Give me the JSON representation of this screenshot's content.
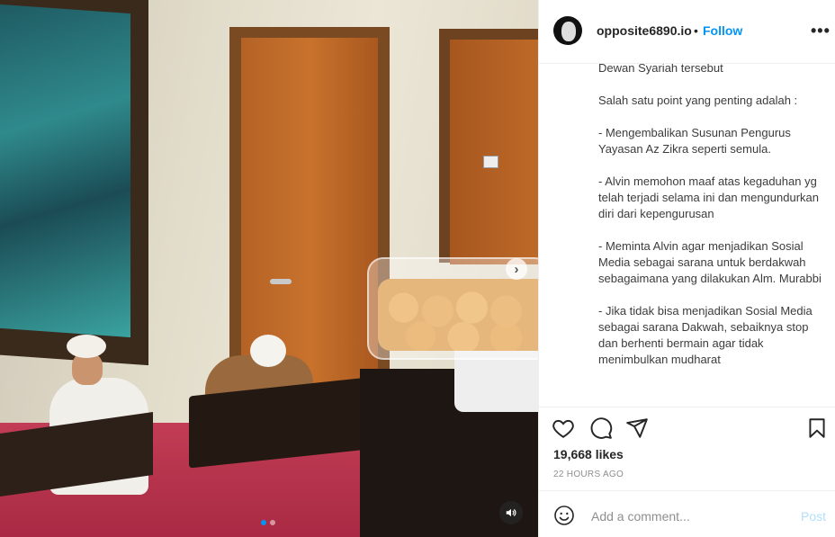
{
  "post": {
    "username": "opposite6890.io",
    "separator": "•",
    "follow_label": "Follow",
    "more_label": "•••",
    "caption_lines": [
      "Dewan Syariah tersebut",
      "Salah satu point yang penting adalah :",
      "- Mengembalikan Susunan Pengurus Yayasan Az Zikra seperti semula.",
      "- Alvin memohon maaf atas kegaduhan yg telah terjadi selama ini dan mengundurkan diri dari kepengurusan",
      "- Meminta Alvin agar menjadikan Sosial Media sebagai sarana untuk berdakwah sebagaimana yang dilakukan Alm. Murabbi",
      "- Jika tidak bisa menjadikan Sosial Media sebagai sarana Dakwah, sebaiknya stop dan berhenti bermain agar tidak menimbulkan mudharat"
    ],
    "likes": "19,668 likes",
    "timestamp": "22 HOURS AGO"
  },
  "comment": {
    "placeholder": "Add a comment...",
    "post_label": "Post"
  },
  "media": {
    "carousel_next": "›",
    "carousel_count": 2,
    "carousel_active": 1
  },
  "icons": {
    "like": "heart-icon",
    "comment": "comment-bubble-icon",
    "share": "paper-plane-icon",
    "save": "bookmark-icon",
    "emoji": "emoji-icon",
    "sound": "speaker-icon"
  },
  "colors": {
    "accent": "#0095f6",
    "post_disabled": "#b2dffc",
    "muted": "#8e8e8e"
  }
}
